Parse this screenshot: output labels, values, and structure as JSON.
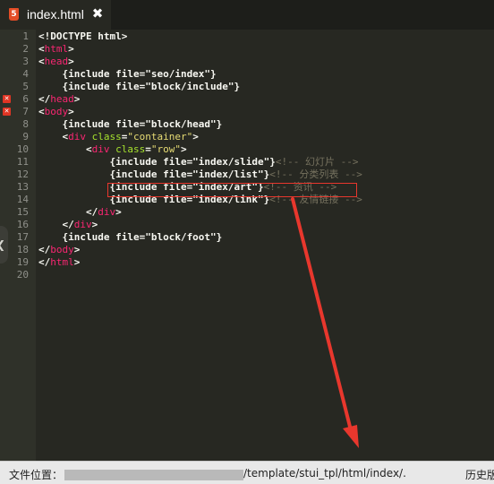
{
  "tab": {
    "icon": "html5-icon",
    "icon_glyph": "5",
    "title": "index.html",
    "close_glyph": "✖"
  },
  "colors": {
    "tag": "#f92672",
    "attr": "#a6e22e",
    "string": "#e6db74",
    "comment": "#75715e",
    "error_marker": "#e03524",
    "annotation": "#e8372d"
  },
  "code_lines": [
    {
      "n": "1",
      "tokens": [
        [
          "t",
          "<!DOCTYPE html>"
        ]
      ]
    },
    {
      "n": "2",
      "tokens": [
        [
          "t",
          "<"
        ],
        [
          "tag",
          "html"
        ],
        [
          "t",
          ">"
        ]
      ]
    },
    {
      "n": "3",
      "tokens": [
        [
          "t",
          "<"
        ],
        [
          "tag",
          "head"
        ],
        [
          "t",
          ">"
        ]
      ]
    },
    {
      "n": "4",
      "tokens": [
        [
          "t",
          "    {include file=\"seo/index\"}"
        ]
      ]
    },
    {
      "n": "5",
      "tokens": [
        [
          "t",
          "    {include file=\"block/include\"}"
        ]
      ]
    },
    {
      "n": "6",
      "error": true,
      "tokens": [
        [
          "t",
          "</"
        ],
        [
          "tag",
          "head"
        ],
        [
          "t",
          ">"
        ]
      ]
    },
    {
      "n": "7",
      "error": true,
      "tokens": [
        [
          "t",
          "<"
        ],
        [
          "tag",
          "body"
        ],
        [
          "t",
          ">"
        ]
      ]
    },
    {
      "n": "8",
      "tokens": [
        [
          "t",
          "    {include file=\"block/head\"}"
        ]
      ]
    },
    {
      "n": "9",
      "tokens": [
        [
          "t",
          "    <"
        ],
        [
          "tag",
          "div"
        ],
        [
          "t",
          " "
        ],
        [
          "attr",
          "class"
        ],
        [
          "t",
          "="
        ],
        [
          "str",
          "\"container\""
        ],
        [
          "t",
          ">"
        ]
      ]
    },
    {
      "n": "10",
      "tokens": [
        [
          "t",
          "        <"
        ],
        [
          "tag",
          "div"
        ],
        [
          "t",
          " "
        ],
        [
          "attr",
          "class"
        ],
        [
          "t",
          "="
        ],
        [
          "str",
          "\"row\""
        ],
        [
          "t",
          ">"
        ]
      ]
    },
    {
      "n": "11",
      "tokens": [
        [
          "t",
          "            {include file=\"index/slide\"}"
        ],
        [
          "cmt",
          "<!-- 幻灯片 -->"
        ]
      ]
    },
    {
      "n": "12",
      "tokens": [
        [
          "t",
          "            {include file=\"index/list\"}"
        ],
        [
          "cmt",
          "<!-- 分类列表 -->"
        ]
      ]
    },
    {
      "n": "13",
      "tokens": [
        [
          "t",
          "            {include file=\"index/art\"}"
        ],
        [
          "cmt",
          "<!-- 资讯 -->"
        ]
      ]
    },
    {
      "n": "14",
      "tokens": [
        [
          "t",
          "            {include file=\"index/link\"}"
        ],
        [
          "cmt",
          "<!-- 友情链接 -->"
        ]
      ]
    },
    {
      "n": "15",
      "tokens": [
        [
          "t",
          "        </"
        ],
        [
          "tag",
          "div"
        ],
        [
          "t",
          ">"
        ]
      ]
    },
    {
      "n": "16",
      "tokens": [
        [
          "t",
          "    </"
        ],
        [
          "tag",
          "div"
        ],
        [
          "t",
          ">"
        ]
      ]
    },
    {
      "n": "17",
      "tokens": [
        [
          "t",
          "    {include file=\"block/foot\"}"
        ]
      ]
    },
    {
      "n": "18",
      "tokens": [
        [
          "t",
          "</"
        ],
        [
          "tag",
          "body"
        ],
        [
          "t",
          ">"
        ]
      ]
    },
    {
      "n": "19",
      "tokens": [
        [
          "t",
          "</"
        ],
        [
          "tag",
          "html"
        ],
        [
          "t",
          ">"
        ]
      ]
    },
    {
      "n": "20",
      "tokens": []
    }
  ],
  "error_marker_glyph": "✕",
  "collapse_handle_glyph": "❮",
  "status": {
    "location_label": "文件位置：",
    "path": "/template/stui_tpl/html/index/.",
    "history_label": "历史版本"
  }
}
